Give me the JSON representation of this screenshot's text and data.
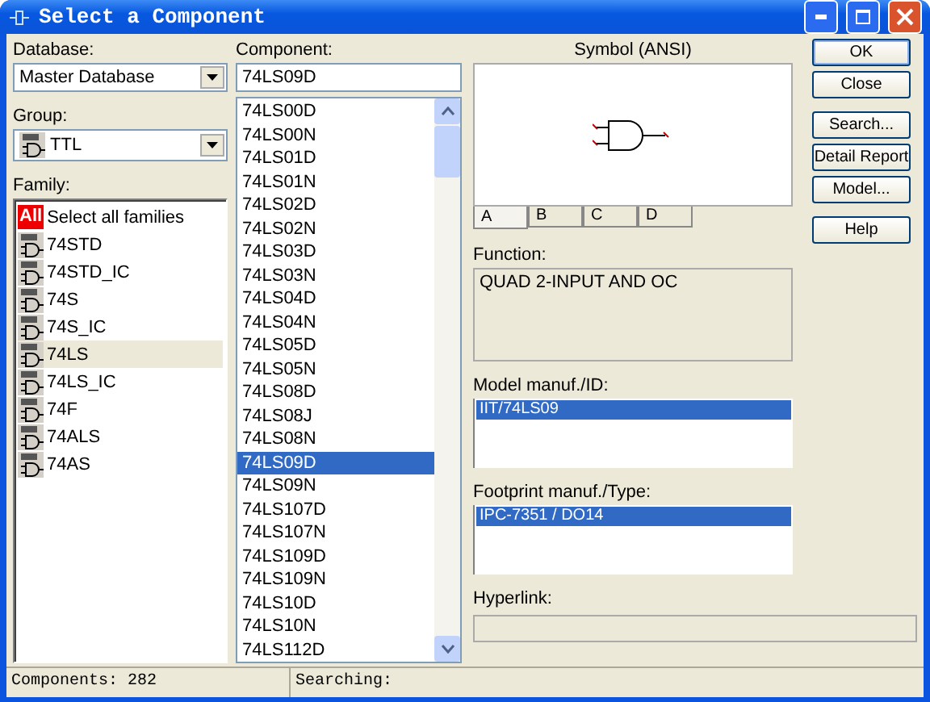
{
  "window": {
    "title": "Select a Component"
  },
  "database": {
    "label": "Database:",
    "value": "Master Database"
  },
  "group": {
    "label": "Group:",
    "value": "TTL"
  },
  "family": {
    "label": "Family:",
    "items": [
      {
        "kind": "all",
        "badge": "All",
        "label": "Select all families",
        "selected": false
      },
      {
        "kind": "gate",
        "label": "74STD",
        "selected": false
      },
      {
        "kind": "gate",
        "label": "74STD_IC",
        "selected": false
      },
      {
        "kind": "gate",
        "label": "74S",
        "selected": false
      },
      {
        "kind": "gate",
        "label": "74S_IC",
        "selected": false
      },
      {
        "kind": "gate",
        "label": "74LS",
        "selected": true
      },
      {
        "kind": "gate",
        "label": "74LS_IC",
        "selected": false
      },
      {
        "kind": "gate",
        "label": "74F",
        "selected": false
      },
      {
        "kind": "gate",
        "label": "74ALS",
        "selected": false
      },
      {
        "kind": "gate",
        "label": "74AS",
        "selected": false
      }
    ]
  },
  "component": {
    "label": "Component:",
    "value": "74LS09D",
    "items": [
      {
        "label": "74LS00D",
        "selected": false
      },
      {
        "label": "74LS00N",
        "selected": false
      },
      {
        "label": "74LS01D",
        "selected": false
      },
      {
        "label": "74LS01N",
        "selected": false
      },
      {
        "label": "74LS02D",
        "selected": false
      },
      {
        "label": "74LS02N",
        "selected": false
      },
      {
        "label": "74LS03D",
        "selected": false
      },
      {
        "label": "74LS03N",
        "selected": false
      },
      {
        "label": "74LS04D",
        "selected": false
      },
      {
        "label": "74LS04N",
        "selected": false
      },
      {
        "label": "74LS05D",
        "selected": false
      },
      {
        "label": "74LS05N",
        "selected": false
      },
      {
        "label": "74LS08D",
        "selected": false
      },
      {
        "label": "74LS08J",
        "selected": false
      },
      {
        "label": "74LS08N",
        "selected": false
      },
      {
        "label": "74LS09D",
        "selected": true
      },
      {
        "label": "74LS09N",
        "selected": false
      },
      {
        "label": "74LS107D",
        "selected": false
      },
      {
        "label": "74LS107N",
        "selected": false
      },
      {
        "label": "74LS109D",
        "selected": false
      },
      {
        "label": "74LS109N",
        "selected": false
      },
      {
        "label": "74LS10D",
        "selected": false
      },
      {
        "label": "74LS10N",
        "selected": false
      },
      {
        "label": "74LS112D",
        "selected": false
      }
    ]
  },
  "symbol": {
    "label": "Symbol (ANSI)",
    "tabs": [
      {
        "label": "A",
        "selected": true
      },
      {
        "label": "B",
        "selected": false
      },
      {
        "label": "C",
        "selected": false
      },
      {
        "label": "D",
        "selected": false
      }
    ]
  },
  "function": {
    "label": "Function:",
    "value": "QUAD 2-INPUT AND OC"
  },
  "model": {
    "label": "Model manuf./ID:",
    "items": [
      {
        "label": "IIT/74LS09",
        "selected": true
      }
    ]
  },
  "footprint": {
    "label": "Footprint manuf./Type:",
    "items": [
      {
        "label": "IPC-7351 / DO14",
        "selected": true
      }
    ]
  },
  "hyperlink": {
    "label": "Hyperlink:"
  },
  "buttons": [
    {
      "label": "OK",
      "default": true
    },
    {
      "label": "Close",
      "default": false
    },
    {
      "label": "Search...",
      "default": false
    },
    {
      "label": "Detail Report",
      "default": false
    },
    {
      "label": "Model...",
      "default": false
    },
    {
      "label": "Help",
      "default": false
    }
  ],
  "status_bar": [
    "Components: 282",
    "Searching:"
  ]
}
